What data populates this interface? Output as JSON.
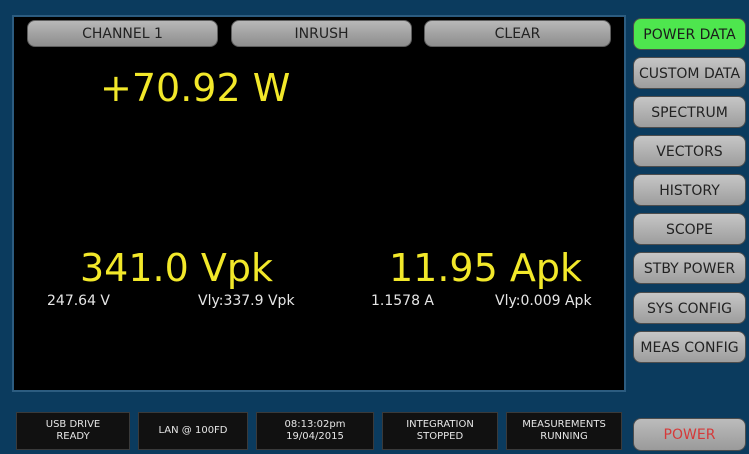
{
  "top_buttons": {
    "channel": "CHANNEL 1",
    "inrush": "INRUSH",
    "clear": "CLEAR"
  },
  "power": {
    "value": "+70.92 W"
  },
  "voltage": {
    "peak": "341.0 Vpk",
    "rms": "247.64 V",
    "valley": "Vly:337.9 Vpk"
  },
  "current": {
    "peak": "11.95 Apk",
    "rms": "1.1578 A",
    "valley": "Vly:0.009 Apk"
  },
  "sidebar": {
    "items": [
      {
        "label": "POWER DATA",
        "active": true
      },
      {
        "label": "CUSTOM DATA"
      },
      {
        "label": "SPECTRUM"
      },
      {
        "label": "VECTORS"
      },
      {
        "label": "HISTORY"
      },
      {
        "label": "SCOPE"
      },
      {
        "label": "STBY POWER"
      },
      {
        "label": "SYS CONFIG"
      },
      {
        "label": "MEAS CONFIG"
      }
    ]
  },
  "status": {
    "usb": {
      "line1": "USB DRIVE",
      "line2": "READY"
    },
    "lan": {
      "line1": "LAN @ 100FD"
    },
    "time": {
      "line1": "08:13:02pm",
      "line2": "19/04/2015"
    },
    "integration": {
      "line1": "INTEGRATION",
      "line2": "STOPPED"
    },
    "measurements": {
      "line1": "MEASUREMENTS",
      "line2": "RUNNING"
    }
  },
  "power_button": {
    "label": "POWER"
  },
  "colors": {
    "accent_green": "#4ee64e",
    "value_yellow": "#f2e82a",
    "power_red": "#d53a3a",
    "frame_blue": "#0b3b5e"
  }
}
